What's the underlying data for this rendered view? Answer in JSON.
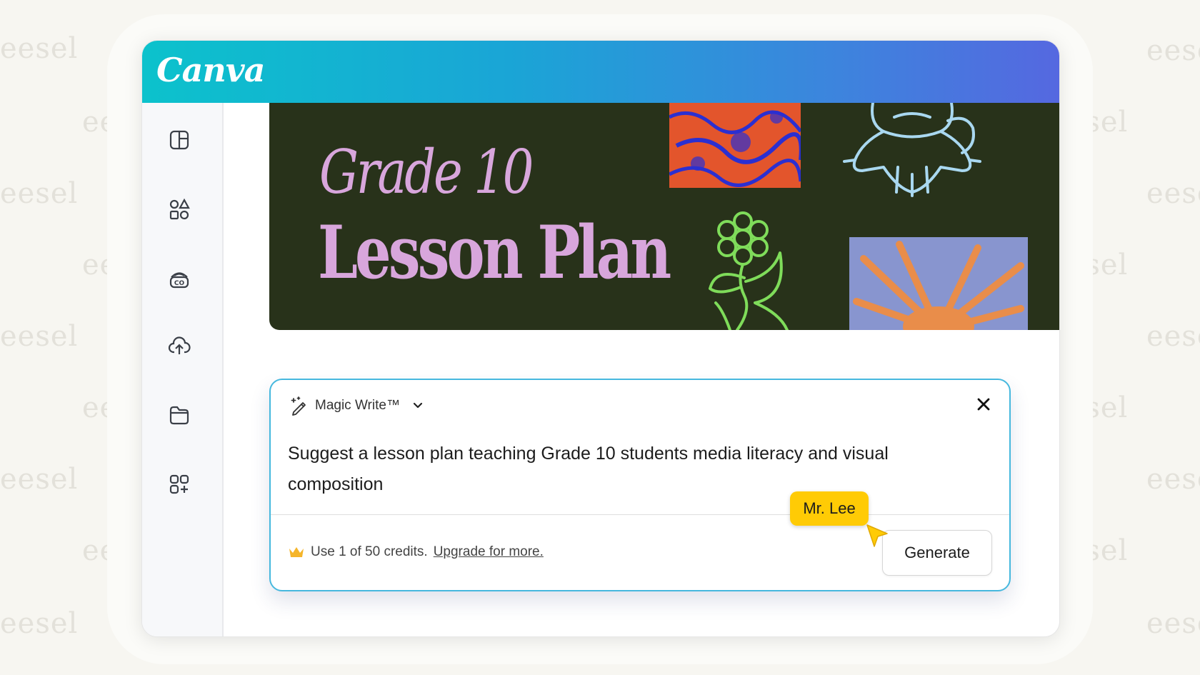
{
  "watermark": "eesel",
  "app": {
    "logo": "Canva"
  },
  "sidebar": {
    "icons": [
      "layout-panel-icon",
      "shapes-elements-icon",
      "brand-icon",
      "upload-cloud-icon",
      "folder-icon",
      "apps-icon"
    ]
  },
  "banner": {
    "title_line1": "Grade 10",
    "title_line2": "Lesson Plan"
  },
  "magic_write": {
    "title": "Magic Write™",
    "prompt": "Suggest a lesson plan teaching Grade 10 students media literacy and visual composition",
    "credits_text": "Use 1 of 50 credits.",
    "upgrade_link": "Upgrade for more.",
    "generate_label": "Generate",
    "border_color": "#46b8de"
  },
  "collaborator": {
    "name": "Mr. Lee",
    "color": "#ffcb05"
  }
}
